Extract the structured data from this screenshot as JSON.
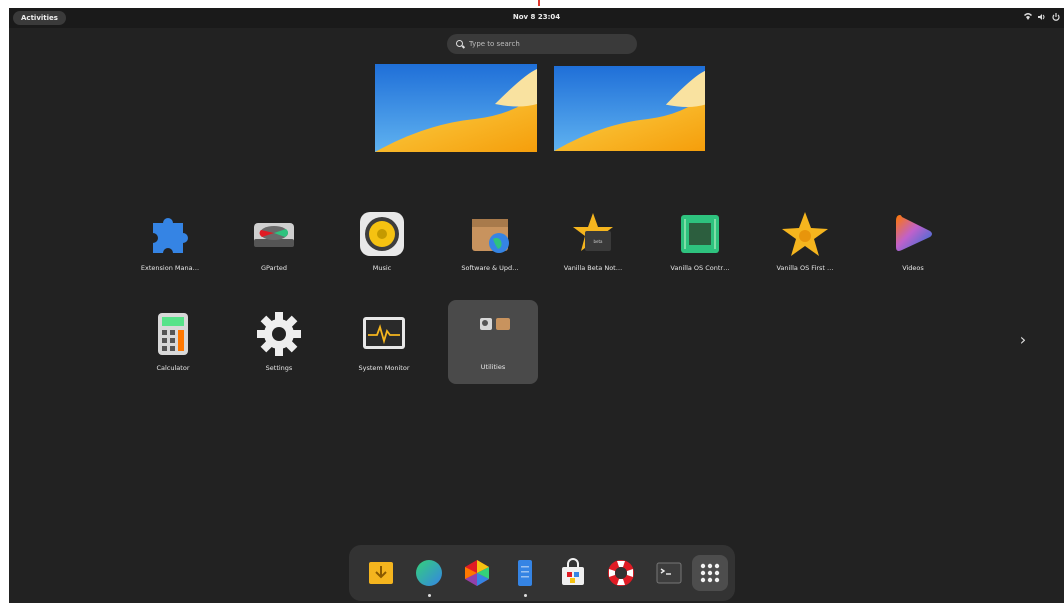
{
  "topbar": {
    "activities_label": "Activities",
    "clock": "Nov 8  23:04"
  },
  "search": {
    "placeholder": "Type to search"
  },
  "apps": [
    {
      "label": "Extension Mana…",
      "icon": "puzzle-icon"
    },
    {
      "label": "GParted",
      "icon": "disk-icon"
    },
    {
      "label": "Music",
      "icon": "speaker-icon"
    },
    {
      "label": "Software & Upd…",
      "icon": "software-box-icon"
    },
    {
      "label": "Vanilla Beta Not…",
      "icon": "vanilla-beta-icon"
    },
    {
      "label": "Vanilla OS Contr…",
      "icon": "chip-icon"
    },
    {
      "label": "Vanilla OS First …",
      "icon": "vanilla-flower-icon"
    },
    {
      "label": "Videos",
      "icon": "play-icon"
    },
    {
      "label": "Calculator",
      "icon": "calculator-icon"
    },
    {
      "label": "Settings",
      "icon": "gear-icon"
    },
    {
      "label": "System Monitor",
      "icon": "monitor-icon"
    },
    {
      "label": "Utilities",
      "icon": "folder-icon"
    }
  ],
  "dock": [
    {
      "name": "downloads-icon",
      "running": false
    },
    {
      "name": "browser-icon",
      "running": true
    },
    {
      "name": "color-hex-icon",
      "running": false
    },
    {
      "name": "phone-icon",
      "running": true
    },
    {
      "name": "store-bag-icon",
      "running": false
    },
    {
      "name": "help-lifebuoy-icon",
      "running": false
    },
    {
      "name": "terminal-icon",
      "running": false
    },
    {
      "name": "app-grid-icon",
      "running": false
    }
  ],
  "colors": {
    "background": "#222222",
    "accent_blue": "#2f7de1",
    "accent_yellow": "#f5b51e"
  }
}
